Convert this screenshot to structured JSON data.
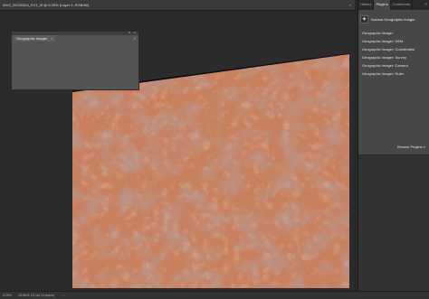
{
  "document": {
    "title": "WV2_20230304_EX1_0f @ 6.25% (Layer 0, RGB/8#)",
    "close_glyph": "×"
  },
  "floating_panel": {
    "tab_label": "Geographic Imager",
    "close_glyph": "×",
    "collapse_glyph": "«",
    "menu_glyph": "≡"
  },
  "right_panel": {
    "tabs": [
      {
        "label": "History",
        "active": false
      },
      {
        "label": "Plugins",
        "active": true
      },
      {
        "label": "Comments",
        "active": false
      }
    ],
    "menu_glyph": "≡",
    "plugin_header": "Avenza Geographic Imager",
    "plugin_icon_glyph": "◈",
    "plugin_items": [
      "Geographic Imager",
      "Geographic Imager: DEM",
      "Geographic Imager: Coordinates",
      "Geographic Imager: Survey",
      "Geographic Imager: Camera",
      "Geographic Imager: Ruler"
    ],
    "browse_label": "Browse Plugins",
    "browse_glyph": "»"
  },
  "status_bar": {
    "zoom": "6.25%",
    "doc_size": "18.8M/1.2G (all 15 layers)",
    "arrow": "›"
  },
  "colors": {
    "terrain_base": "#c9805f",
    "terrain_dark": "#9e7464",
    "terrain_light": "#dea283",
    "nodata": "#0b0b0b"
  }
}
